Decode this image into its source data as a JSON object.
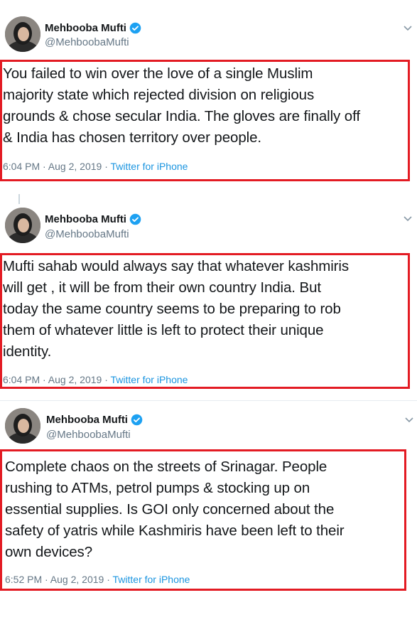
{
  "tweets": [
    {
      "name": "Mehbooba Mufti",
      "handle": "@MehboobaMufti",
      "lines": [
        "You failed to win over the love of a single Muslim",
        "majority state which  rejected division on religious",
        "grounds & chose secular India. The gloves are finally off",
        "& India has chosen territory over people."
      ],
      "time": "6:04 PM · Aug 2, 2019 · ",
      "source": "Twitter for iPhone"
    },
    {
      "name": "Mehbooba Mufti",
      "handle": "@MehboobaMufti",
      "lines": [
        "Mufti sahab would always say that whatever kashmiris",
        "will get , it will be from their own country India. But",
        "today the same country seems to be preparing to rob",
        "them of whatever little is left to protect their unique",
        "identity."
      ],
      "time": "6:04 PM · Aug 2, 2019 · ",
      "source": "Twitter for iPhone"
    },
    {
      "name": "Mehbooba Mufti",
      "handle": "@MehboobaMufti",
      "lines": [
        "Complete chaos on the streets of Srinagar. People",
        "rushing to ATMs, petrol pumps & stocking up on",
        "essential supplies. Is GOI only concerned about the",
        "safety of yatris while Kashmiris have been left to their",
        "own devices?"
      ],
      "time": "6:52 PM · Aug 2, 2019 · ",
      "source": "Twitter for iPhone"
    }
  ],
  "icons": {
    "verified": "verified-badge-icon",
    "more": "chevron-down-icon",
    "highlight_color": "#e31b23",
    "link_color": "#1b95e0"
  }
}
